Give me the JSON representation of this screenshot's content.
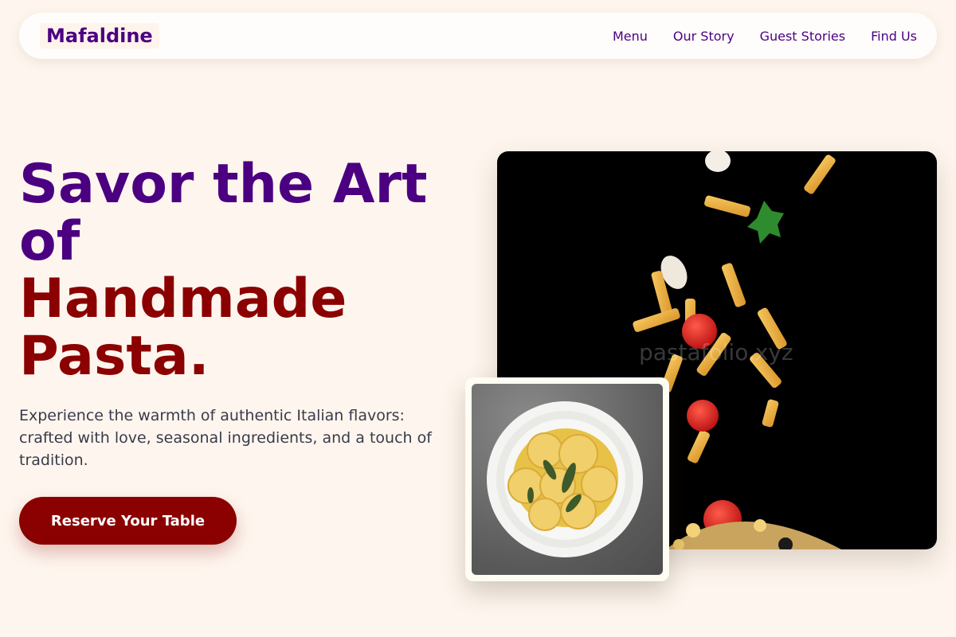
{
  "nav": {
    "brand": "Mafaldine",
    "links": [
      {
        "label": "Menu"
      },
      {
        "label": "Our Story"
      },
      {
        "label": "Guest Stories"
      },
      {
        "label": "Find Us"
      }
    ]
  },
  "hero": {
    "title_line1": "Savor the Art of",
    "title_line2": "Handmade Pasta.",
    "description": "Experience the warmth of authentic Italian flavors: crafted with love, seasonal ingredients, and a touch of tradition.",
    "cta_label": "Reserve Your Table"
  },
  "images": {
    "main_photo_watermark": "pastafolio.xyz"
  },
  "colors": {
    "background": "#fef6ee",
    "brand_purple": "#4b0082",
    "accent_red": "#8b0000"
  }
}
